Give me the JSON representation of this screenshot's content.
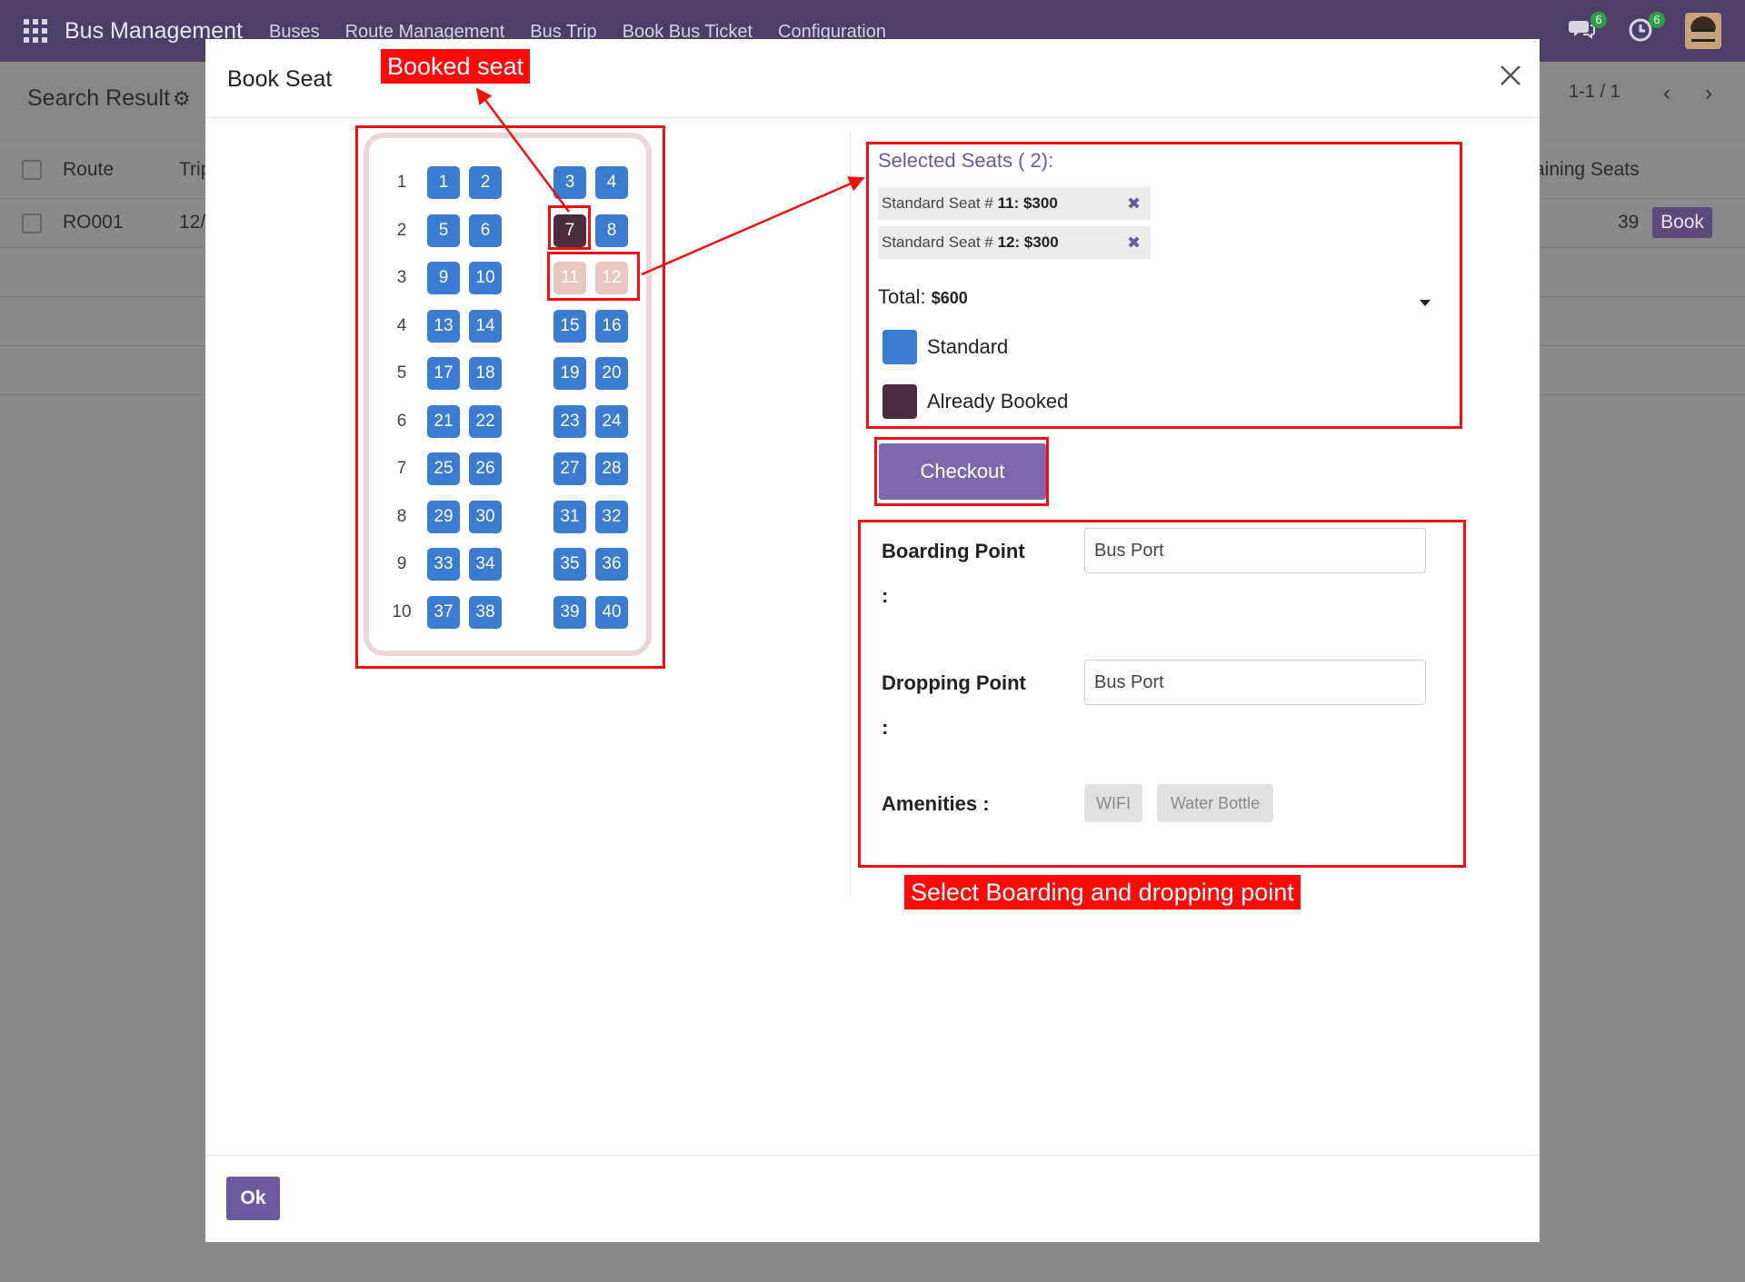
{
  "navbar": {
    "brand": "Bus Management",
    "menu": [
      "Buses",
      "Route Management",
      "Bus Trip",
      "Book Bus Ticket",
      "Configuration"
    ],
    "messages_badge": "6",
    "activity_badge": "6"
  },
  "control_panel": {
    "title": "Search Result",
    "pager": "1-1 / 1"
  },
  "list": {
    "headers": [
      "Route",
      "Trip",
      "aining Seats"
    ],
    "row": {
      "route": "RO001",
      "trip": "12/",
      "remaining": "39",
      "action": "Book"
    }
  },
  "modal": {
    "title": "Book Seat",
    "ok_label": "Ok"
  },
  "seat_map": {
    "rows": [
      {
        "row": "1",
        "seats": [
          {
            "n": "1",
            "s": "available"
          },
          {
            "n": "2",
            "s": "available"
          },
          {
            "n": "3",
            "s": "available"
          },
          {
            "n": "4",
            "s": "available"
          }
        ]
      },
      {
        "row": "2",
        "seats": [
          {
            "n": "5",
            "s": "available"
          },
          {
            "n": "6",
            "s": "available"
          },
          {
            "n": "7",
            "s": "booked"
          },
          {
            "n": "8",
            "s": "available"
          }
        ]
      },
      {
        "row": "3",
        "seats": [
          {
            "n": "9",
            "s": "available"
          },
          {
            "n": "10",
            "s": "available"
          },
          {
            "n": "11",
            "s": "selected"
          },
          {
            "n": "12",
            "s": "selected"
          }
        ]
      },
      {
        "row": "4",
        "seats": [
          {
            "n": "13",
            "s": "available"
          },
          {
            "n": "14",
            "s": "available"
          },
          {
            "n": "15",
            "s": "available"
          },
          {
            "n": "16",
            "s": "available"
          }
        ]
      },
      {
        "row": "5",
        "seats": [
          {
            "n": "17",
            "s": "available"
          },
          {
            "n": "18",
            "s": "available"
          },
          {
            "n": "19",
            "s": "available"
          },
          {
            "n": "20",
            "s": "available"
          }
        ]
      },
      {
        "row": "6",
        "seats": [
          {
            "n": "21",
            "s": "available"
          },
          {
            "n": "22",
            "s": "available"
          },
          {
            "n": "23",
            "s": "available"
          },
          {
            "n": "24",
            "s": "available"
          }
        ]
      },
      {
        "row": "7",
        "seats": [
          {
            "n": "25",
            "s": "available"
          },
          {
            "n": "26",
            "s": "available"
          },
          {
            "n": "27",
            "s": "available"
          },
          {
            "n": "28",
            "s": "available"
          }
        ]
      },
      {
        "row": "8",
        "seats": [
          {
            "n": "29",
            "s": "available"
          },
          {
            "n": "30",
            "s": "available"
          },
          {
            "n": "31",
            "s": "available"
          },
          {
            "n": "32",
            "s": "available"
          }
        ]
      },
      {
        "row": "9",
        "seats": [
          {
            "n": "33",
            "s": "available"
          },
          {
            "n": "34",
            "s": "available"
          },
          {
            "n": "35",
            "s": "available"
          },
          {
            "n": "36",
            "s": "available"
          }
        ]
      },
      {
        "row": "10",
        "seats": [
          {
            "n": "37",
            "s": "available"
          },
          {
            "n": "38",
            "s": "available"
          },
          {
            "n": "39",
            "s": "available"
          },
          {
            "n": "40",
            "s": "available"
          }
        ]
      }
    ]
  },
  "selection": {
    "title": "Selected Seats ( 2):",
    "items": [
      {
        "prefix": "Standard Seat # ",
        "detail": "11: $300"
      },
      {
        "prefix": "Standard Seat # ",
        "detail": "12: $300"
      }
    ],
    "total_label": "Total:",
    "total_value": "$600",
    "legend": [
      {
        "label": "Standard",
        "color": "#3b7bd0"
      },
      {
        "label": "Already Booked",
        "color": "#4a2d3c"
      }
    ],
    "checkout_label": "Checkout"
  },
  "trip_form": {
    "boarding_label": "Boarding Point",
    "boarding_value": "Bus Port",
    "dropping_label": "Dropping Point",
    "dropping_value": "Bus Port",
    "colon": ":",
    "amenities_label": "Amenities :",
    "amenities": [
      "WIFI",
      "Water Bottle"
    ]
  },
  "annotations": {
    "booked_seat": "Booked seat",
    "select_points": "Select Boarding and dropping point"
  },
  "colors": {
    "navbar": "#4b3f67",
    "seat_available": "#3b7bd0",
    "seat_booked": "#4a2d3c",
    "seat_selected": "#e8c7c3",
    "accent": "#7c69ad",
    "annotation": "#ff0a0a"
  }
}
